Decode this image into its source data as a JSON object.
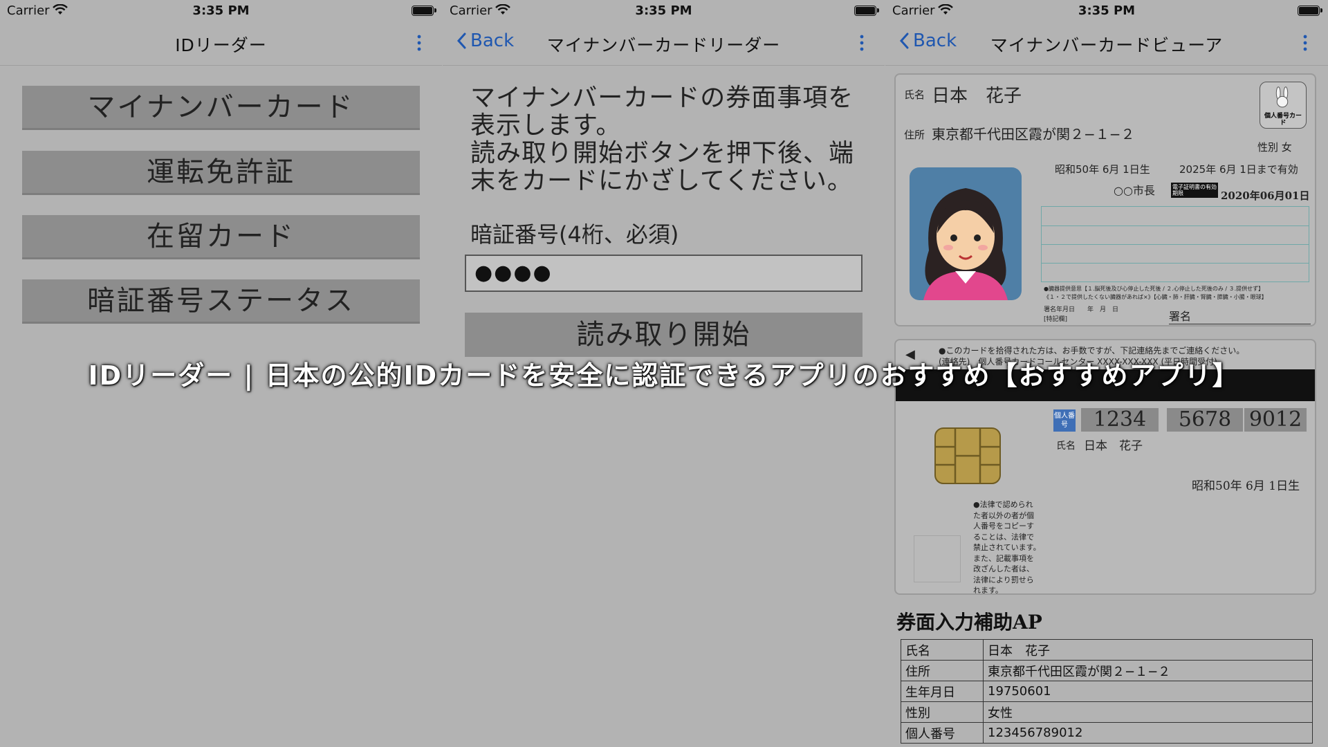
{
  "status": {
    "carrier": "Carrier",
    "time": "3:35 PM"
  },
  "screen1": {
    "title": "IDリーダー",
    "buttons": [
      "マイナンバーカード",
      "運転免許証",
      "在留カード",
      "暗証番号ステータス"
    ]
  },
  "screen2": {
    "back": "Back",
    "title": "マイナンバーカードリーダー",
    "desc_lines": [
      "マイナンバーカードの券面事項を",
      "表示します。",
      "読み取り開始ボタンを押下後、端",
      "末をカードにかざしてください。"
    ],
    "pin_label": "暗証番号(4桁、必須)",
    "pin_value": "●●●●",
    "start": "読み取り開始"
  },
  "screen3": {
    "back": "Back",
    "title": "マイナンバーカードビューア",
    "front": {
      "name_label": "氏名",
      "name": "日本　花子",
      "addr_label": "住所",
      "address": "東京都千代田区霞が関２−１−２",
      "sex": "性別 女",
      "birth": "昭和50年 6月 1日生",
      "expiry": "2025年 6月 1日まで有効",
      "mayor": "○○市長",
      "cert_badge": "電子証明書の有効期限",
      "cert_date": "2020年06月01日",
      "logo_text": "個人番号カード",
      "organ_line1": "●臓器提供意思【１.脳死後及び心停止した死後 / ２.心停止した死後のみ / ３.提供せず】",
      "organ_line2": "《１・２で提供したくない臓器があれば×》【心臓・肺・肝臓・腎臓・膵臓・小腸・眼球】",
      "sign_date": "署名年月日　　年　月　日",
      "special": "[特記欄]",
      "signature": "署名"
    },
    "back_card": {
      "notice1": "●このカードを拾得された方は、お手数ですが、下記連絡先までご連絡ください。",
      "notice2": "(連絡先)　個人番号カードコールセンター XXXX-XXX-XXX (平日時間受付)",
      "num_label": "個人番号",
      "numbers": [
        "1234",
        "5678",
        "9012"
      ],
      "name_label": "氏名",
      "name": "日本　花子",
      "birth": "昭和50年 6月 1日生",
      "law_lines": [
        "●法律で認められ",
        "た者以外の者が個",
        "人番号をコピーす",
        "ることは、法律で",
        "禁止されています。",
        "また、記載事項を",
        "改ざんした者は、",
        "法律により罰せら",
        "れます。"
      ]
    },
    "section_title": "券面入力補助AP",
    "table": [
      {
        "k": "氏名",
        "v": "日本　花子"
      },
      {
        "k": "住所",
        "v": "東京都千代田区霞が関２−１−２"
      },
      {
        "k": "生年月日",
        "v": "19750601"
      },
      {
        "k": "性別",
        "v": "女性"
      },
      {
        "k": "個人番号",
        "v": "123456789012"
      }
    ]
  },
  "overlay_title": "IDリーダー | 日本の公的IDカードを安全に認証できるアプリのおすすめ【おすすめアプリ】",
  "colors": {
    "link": "#1f57b0",
    "button": "#8d8d8d",
    "background": "#b3b3b3"
  }
}
